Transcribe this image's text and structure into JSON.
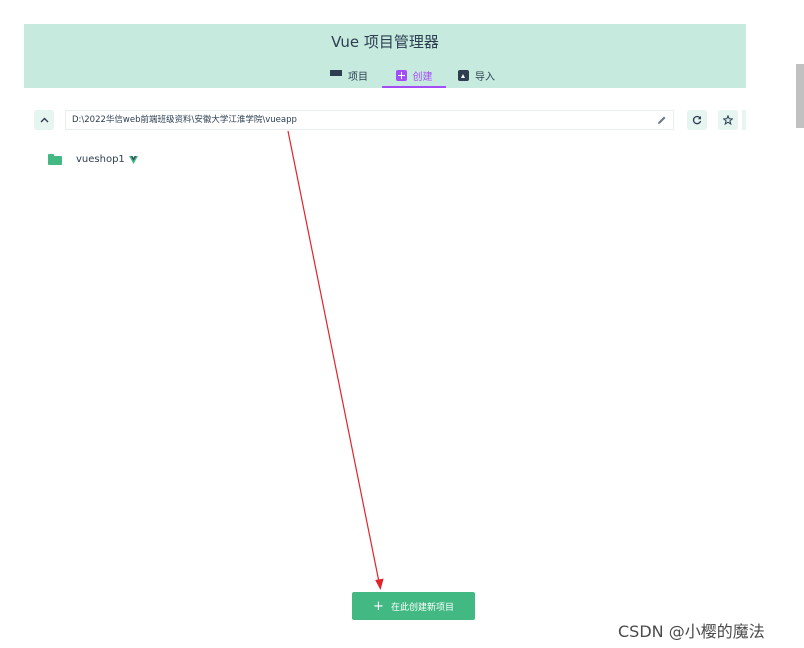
{
  "header": {
    "title": "Vue 项目管理器",
    "tabs": [
      {
        "label": "项目",
        "icon": "list-icon"
      },
      {
        "label": "创建",
        "icon": "add-box-icon",
        "active": true
      },
      {
        "label": "导入",
        "icon": "unarchive-icon"
      }
    ],
    "accent_color": "#a44cf6",
    "background_color": "#c6eadd"
  },
  "pathbar": {
    "up_icon": "chevron-up-icon",
    "path": "D:\\2022华信web前端班级资料\\安徽大学江淮学院\\vueapp",
    "edit_icon": "pencil-icon",
    "refresh_icon": "refresh-icon",
    "favorite_icon": "star-icon"
  },
  "folders": [
    {
      "name": "vueshop1",
      "icon": "folder-icon",
      "badge_icon": "vue-logo-icon"
    }
  ],
  "actions": {
    "create_here_label": "在此创建新项目",
    "create_here_icon": "plus-icon",
    "brand_color": "#42b983"
  },
  "annotation": {
    "arrow_color": "#e0242b"
  },
  "watermark": {
    "text": "CSDN @小樱的魔法"
  }
}
